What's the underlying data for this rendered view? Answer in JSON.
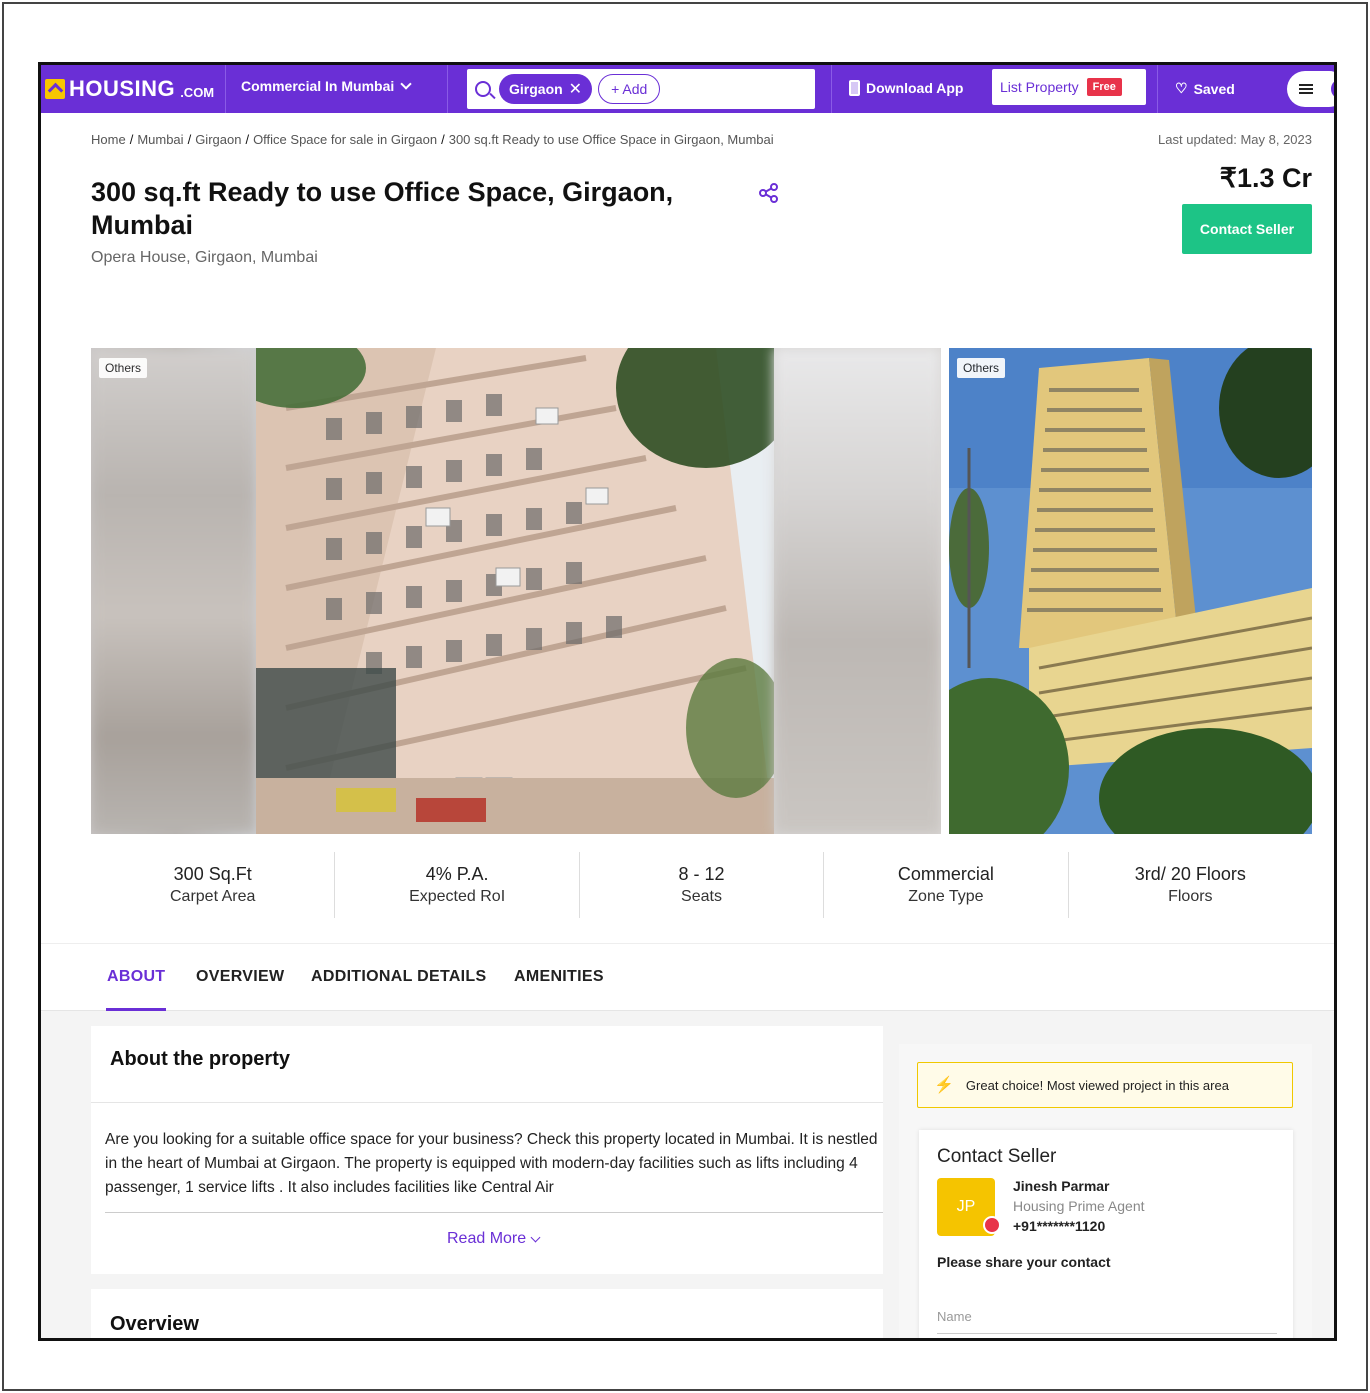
{
  "nav": {
    "logo_text": "HOUSING",
    "logo_sub": ".COM",
    "category": "Commercial In Mumbai",
    "search_chip": "Girgaon",
    "add_chip": "+ Add",
    "download_app": "Download App",
    "list_property": "List Property",
    "free_badge": "Free",
    "saved": "Saved"
  },
  "breadcrumb": [
    "Home",
    "Mumbai",
    "Girgaon",
    "Office Space for sale in Girgaon",
    "300 sq.ft Ready to use Office Space in Girgaon, Mumbai"
  ],
  "last_updated": "Last updated: May 8, 2023",
  "listing": {
    "title": "300 sq.ft Ready to use Office Space, Girgaon, Mumbai",
    "location": "Opera House, Girgaon, Mumbai",
    "price": "₹1.3 Cr",
    "contact_button": "Contact Seller"
  },
  "gallery": {
    "tag1": "Others",
    "tag2": "Others"
  },
  "stats": [
    {
      "value": "300 Sq.Ft",
      "label": "Carpet Area"
    },
    {
      "value": "4% P.A.",
      "label": "Expected RoI"
    },
    {
      "value": "8 - 12",
      "label": "Seats"
    },
    {
      "value": "Commercial",
      "label": "Zone Type"
    },
    {
      "value": "3rd/ 20 Floors",
      "label": "Floors"
    }
  ],
  "tabs": [
    "ABOUT",
    "OVERVIEW",
    "ADDITIONAL DETAILS",
    "AMENITIES"
  ],
  "about": {
    "title": "About the property",
    "text": "Are you looking for a suitable office space for your business? Check this property located in Mumbai. It is nestled in the heart of Mumbai at Girgaon. The property is equipped with modern-day facilities such as lifts including 4 passenger, 1 service lifts . It also includes facilities like Central Air",
    "read_more": "Read More"
  },
  "overview": {
    "title": "Overview"
  },
  "side": {
    "great_choice": "Great choice! Most viewed project in this area",
    "contact_title": "Contact Seller",
    "agent_initials": "JP",
    "agent_name": "Jinesh Parmar",
    "agent_role": "Housing Prime Agent",
    "agent_phone": "+91*******1120",
    "share_prompt": "Please share your contact",
    "name_placeholder": "Name"
  },
  "colors": {
    "brand": "#6a2fd6",
    "cta": "#1dc486",
    "accent_yellow": "#f5c400"
  }
}
